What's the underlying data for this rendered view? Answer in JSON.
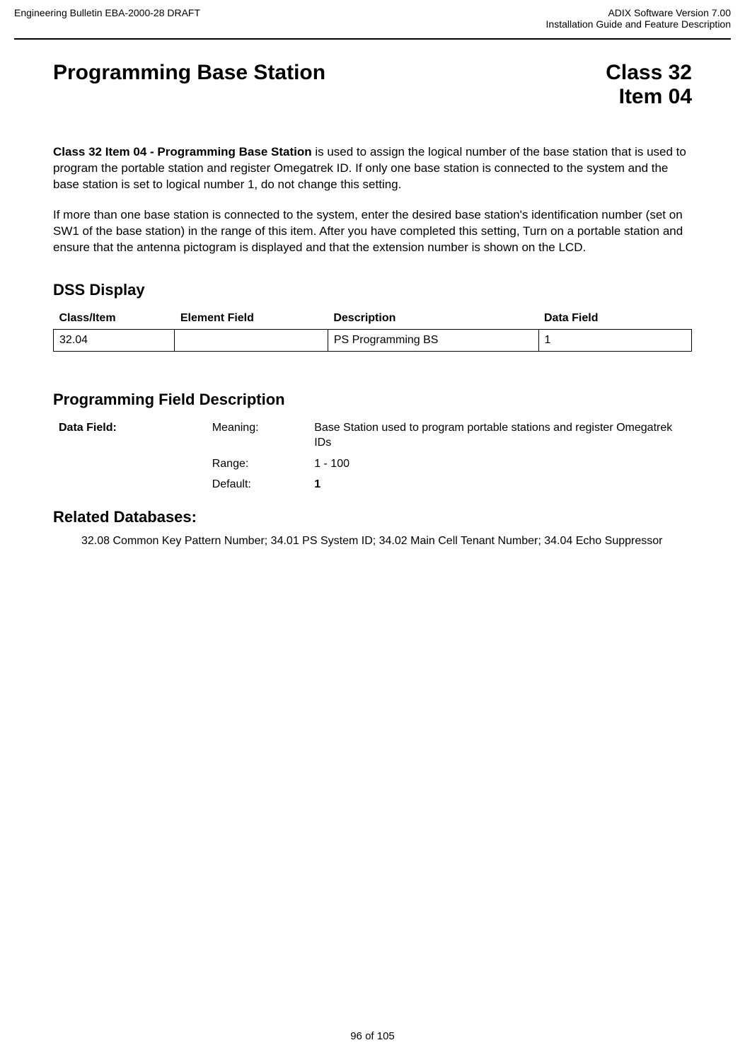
{
  "header": {
    "left": "Engineering Bulletin EBA-2000-28 DRAFT",
    "right_line1": "ADIX Software Version 7.00",
    "right_line2": "Installation Guide and Feature Description"
  },
  "title": {
    "left": "Programming Base Station",
    "right_line1": "Class 32",
    "right_line2": "Item 04"
  },
  "intro": {
    "bold_lead": "Class 32 Item 04 - Programming Base Station",
    "para1_rest": " is used to assign the logical number of the base station that is used to program the portable station and register Omegatrek ID. If only one base station is connected to the system and the base station is set to logical number 1, do not change this setting.",
    "para2": "If more than one base station is connected to the system, enter the desired base station's identification number (set on SW1 of the base station) in the range of this item.  After you have completed this setting, Turn on a portable station and ensure that the antenna pictogram is displayed and that the extension number is shown on the LCD."
  },
  "dss": {
    "heading": "DSS Display",
    "headers": {
      "col1": "Class/Item",
      "col2": "Element Field",
      "col3": "Description",
      "col4": "Data Field"
    },
    "row": {
      "class_item": "32.04",
      "element_field": "",
      "description": "PS Programming BS",
      "data_field": "1"
    }
  },
  "pfd": {
    "heading": "Programming Field Description",
    "data_field_label": "Data Field:",
    "meaning_label": "Meaning:",
    "meaning_value": "Base Station used to program portable stations and register Omegatrek IDs",
    "range_label": "Range:",
    "range_value": "1 - 100",
    "default_label": "Default:",
    "default_value": "1"
  },
  "related": {
    "heading": "Related Databases:",
    "text": "32.08 Common Key Pattern Number; 34.01 PS System ID; 34.02 Main Cell Tenant Number; 34.04 Echo Suppressor"
  },
  "footer": {
    "page": "96 of 105"
  }
}
